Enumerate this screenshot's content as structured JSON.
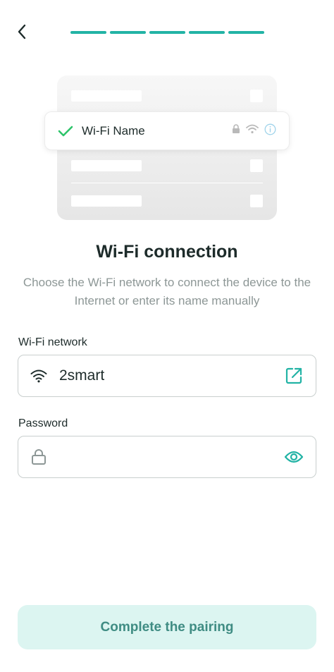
{
  "header": {
    "back_icon": "chevron-left-icon",
    "progress_steps_total": 5,
    "progress_steps_completed": 5,
    "accent_color": "#22b3a5"
  },
  "illustration": {
    "network_name": "Wi-Fi Name",
    "icons": [
      "check-icon",
      "lock-icon",
      "wifi-icon",
      "info-icon"
    ]
  },
  "title": "Wi-Fi connection",
  "subtitle": "Choose the Wi-Fi network to connect the device to the Internet or enter its name manually",
  "wifi_field": {
    "label": "Wi-Fi network",
    "value": "2smart",
    "lead_icon": "wifi-icon",
    "trail_icon": "external-link-icon"
  },
  "password_field": {
    "label": "Password",
    "value": "",
    "lead_icon": "lock-icon",
    "trail_icon": "eye-icon"
  },
  "cta": {
    "label": "Complete the pairing",
    "background": "#dcf5f1",
    "text_color": "#3f8c83"
  }
}
